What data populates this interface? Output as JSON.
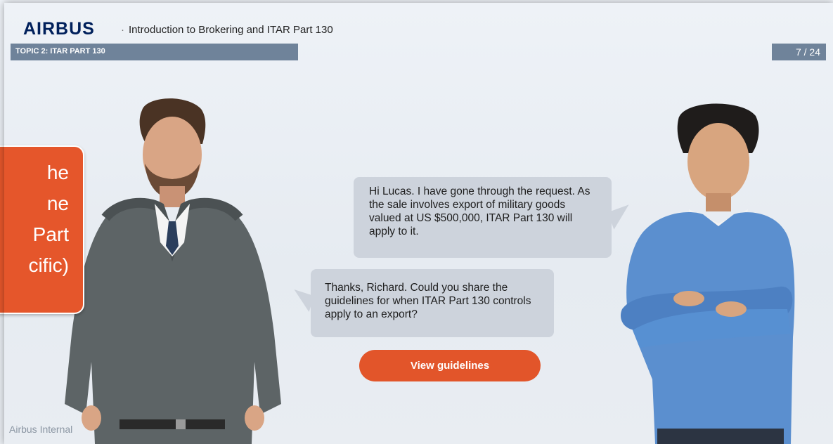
{
  "header": {
    "logo": "AIRBUS",
    "bullet": "·",
    "course_title": "Introduction to Brokering and ITAR Part 130",
    "topic": "TOPIC 2: ITAR PART 130",
    "page_counter": "7 / 24"
  },
  "dialogue": {
    "richard": "Hi Lucas. I have gone through the request. As the sale involves export of military goods valued at US $500,000, ITAR Part 130 will apply to it.",
    "lucas": "Thanks, Richard. Could you share the guidelines for when ITAR Part 130 controls apply to an export?"
  },
  "buttons": {
    "view_guidelines": "View guidelines"
  },
  "footer": {
    "classification": "Airbus Internal"
  },
  "callout": {
    "lines": [
      "he",
      "ne",
      "Part",
      "cific)"
    ]
  },
  "colors": {
    "accent": "#e2552a",
    "topic_bar": "#6f839a",
    "logo": "#00205b",
    "bubble": "#cdd3dc"
  }
}
